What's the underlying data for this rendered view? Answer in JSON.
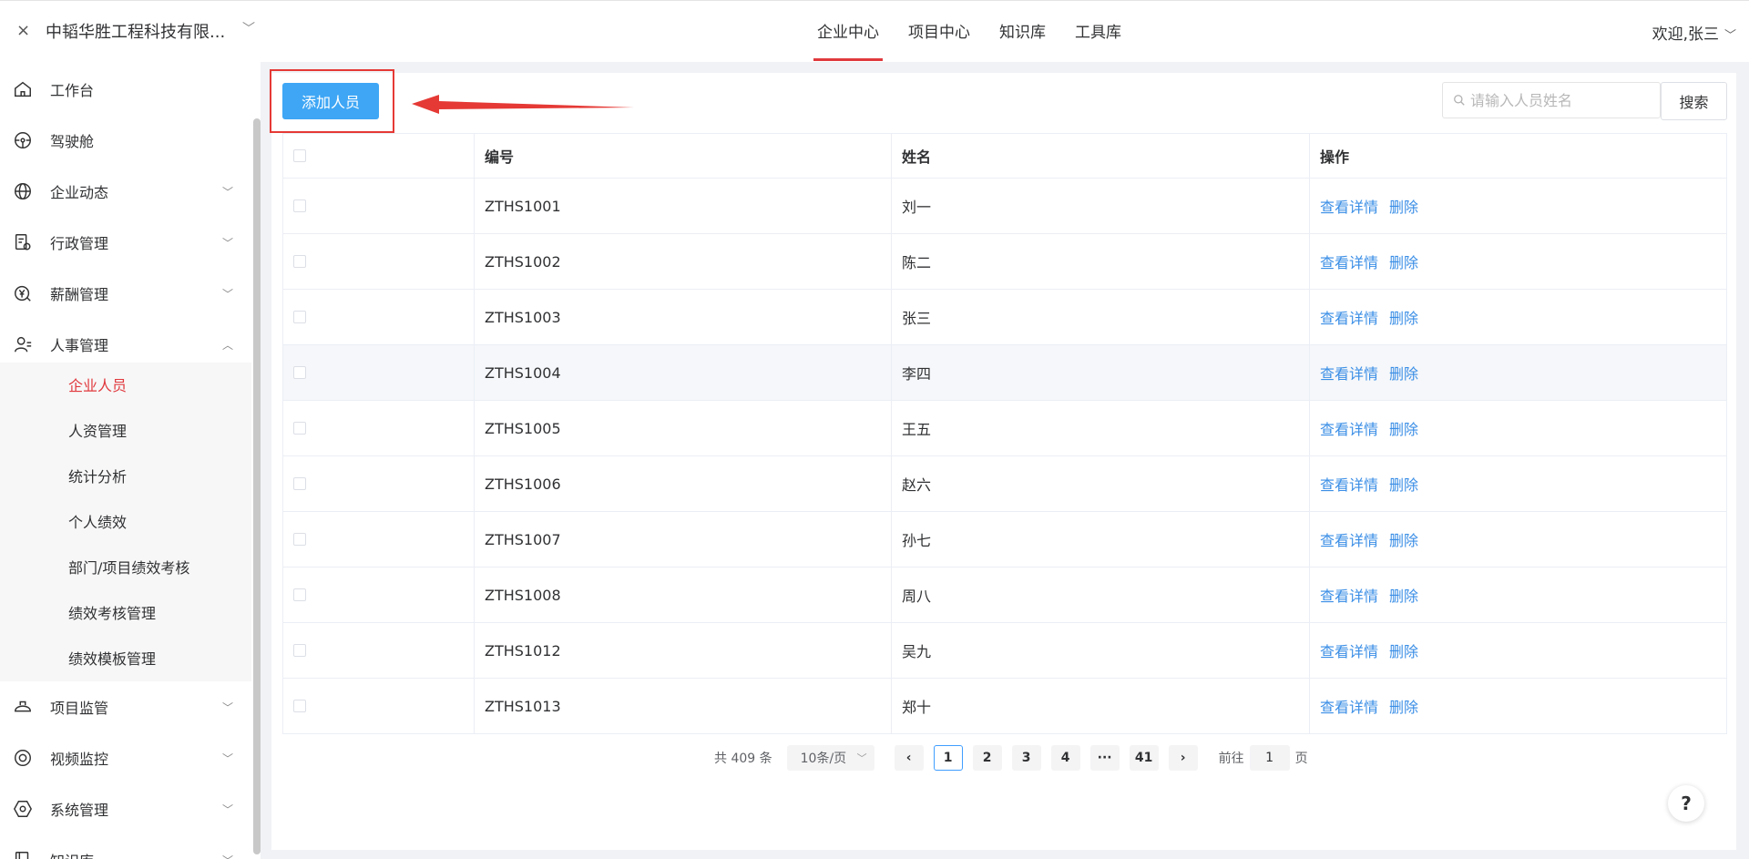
{
  "header": {
    "close": "×",
    "company": "中韬华胜工程科技有限...",
    "nav": [
      "企业中心",
      "项目中心",
      "知识库",
      "工具库"
    ],
    "welcome": "欢迎,张三"
  },
  "sidebar": {
    "items": [
      {
        "label": "工作台",
        "icon": "home-icon"
      },
      {
        "label": "驾驶舱",
        "icon": "dashboard-icon"
      },
      {
        "label": "企业动态",
        "icon": "globe-icon"
      },
      {
        "label": "行政管理",
        "icon": "admin-icon"
      },
      {
        "label": "薪酬管理",
        "icon": "yen-icon"
      },
      {
        "label": "人事管理",
        "icon": "person-icon"
      },
      {
        "label": "项目监管",
        "icon": "helmet-icon"
      },
      {
        "label": "视频监控",
        "icon": "camera-icon"
      },
      {
        "label": "系统管理",
        "icon": "hexagon-icon"
      },
      {
        "label": "知识库",
        "icon": "book-icon"
      }
    ],
    "submenu": [
      "企业人员",
      "人资管理",
      "统计分析",
      "个人绩效",
      "部门/项目绩效考核",
      "绩效考核管理",
      "绩效模板管理"
    ]
  },
  "toolbar": {
    "add_label": "添加人员",
    "search_placeholder": "请输入人员姓名",
    "search_label": "搜索"
  },
  "table": {
    "columns": [
      "编号",
      "姓名",
      "操作"
    ],
    "rows": [
      {
        "id": "ZTHS1001",
        "name": "刘一"
      },
      {
        "id": "ZTHS1002",
        "name": "陈二"
      },
      {
        "id": "ZTHS1003",
        "name": "张三"
      },
      {
        "id": "ZTHS1004",
        "name": "李四"
      },
      {
        "id": "ZTHS1005",
        "name": "王五"
      },
      {
        "id": "ZTHS1006",
        "name": "赵六"
      },
      {
        "id": "ZTHS1007",
        "name": "孙七"
      },
      {
        "id": "ZTHS1008",
        "name": "周八"
      },
      {
        "id": "ZTHS1012",
        "name": "吴九"
      },
      {
        "id": "ZTHS1013",
        "name": "郑十"
      }
    ],
    "action_view": "查看详情",
    "action_delete": "删除"
  },
  "pagination": {
    "total": "共 409 条",
    "page_size": "10条/页",
    "pages": [
      "1",
      "2",
      "3",
      "4",
      "···",
      "41"
    ],
    "current": "1",
    "goto_prefix": "前往",
    "goto_value": "1",
    "goto_suffix": "页"
  },
  "help": "?",
  "colors": {
    "accent": "#e0393e",
    "primary": "#3ea6f5",
    "link": "#3a8ee6",
    "highlight_border": "#e53935"
  }
}
